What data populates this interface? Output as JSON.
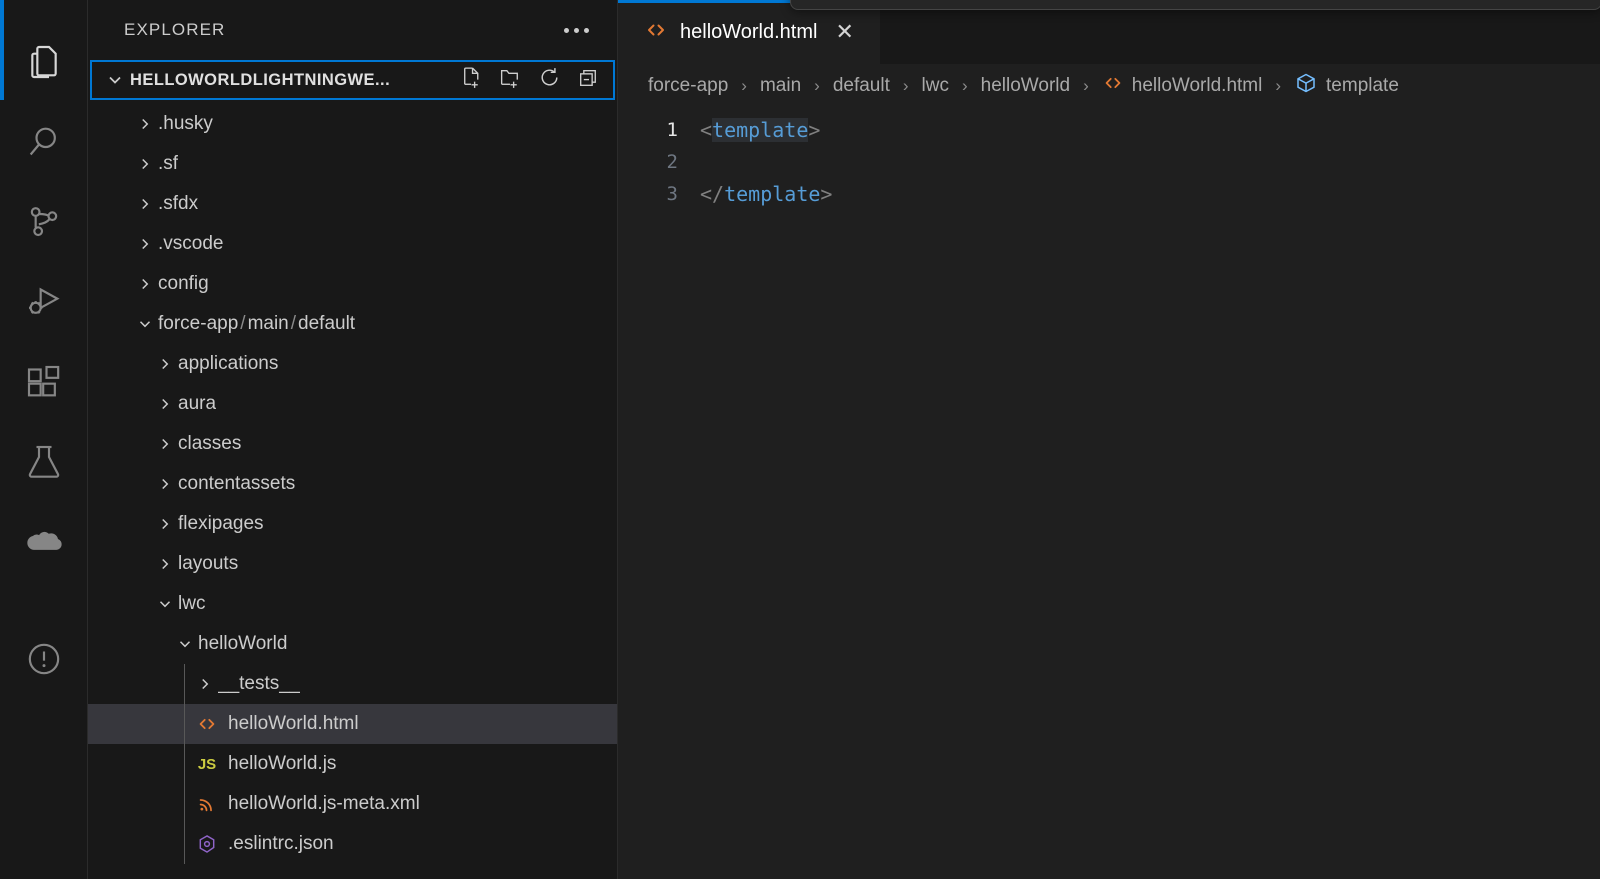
{
  "activitybar": {
    "items": [
      {
        "name": "explorer",
        "icon": "files-icon",
        "active": true
      },
      {
        "name": "search",
        "icon": "search-icon",
        "active": false
      },
      {
        "name": "source-control",
        "icon": "source-control-icon",
        "active": false
      },
      {
        "name": "run-and-debug",
        "icon": "run-debug-icon",
        "active": false
      },
      {
        "name": "extensions",
        "icon": "extensions-icon",
        "active": false
      },
      {
        "name": "testing",
        "icon": "beaker-icon",
        "active": false
      },
      {
        "name": "salesforce",
        "icon": "cloud-icon",
        "active": false
      },
      {
        "name": "problems",
        "icon": "warning-circle-icon",
        "active": false
      }
    ]
  },
  "sidebar": {
    "title": "EXPLORER",
    "more_actions_label": "...",
    "root": {
      "label": "HELLOWORLDLIGHTNINGWE...",
      "expanded": true,
      "actions": [
        {
          "name": "new-file",
          "label": "New File..."
        },
        {
          "name": "new-folder",
          "label": "New Folder..."
        },
        {
          "name": "refresh-explorer",
          "label": "Refresh Explorer"
        },
        {
          "name": "collapse-folders",
          "label": "Collapse Folders in Explorer"
        }
      ]
    },
    "tree": [
      {
        "label": ".husky",
        "kind": "folder",
        "expanded": false,
        "depth": 1
      },
      {
        "label": ".sf",
        "kind": "folder",
        "expanded": false,
        "depth": 1
      },
      {
        "label": ".sfdx",
        "kind": "folder",
        "expanded": false,
        "depth": 1
      },
      {
        "label": ".vscode",
        "kind": "folder",
        "expanded": false,
        "depth": 1
      },
      {
        "label": "config",
        "kind": "folder",
        "expanded": false,
        "depth": 1
      },
      {
        "label": "force-app",
        "label2": "main",
        "label3": "default",
        "kind": "folder-compact",
        "expanded": true,
        "depth": 1
      },
      {
        "label": "applications",
        "kind": "folder",
        "expanded": false,
        "depth": 2
      },
      {
        "label": "aura",
        "kind": "folder",
        "expanded": false,
        "depth": 2
      },
      {
        "label": "classes",
        "kind": "folder",
        "expanded": false,
        "depth": 2
      },
      {
        "label": "contentassets",
        "kind": "folder",
        "expanded": false,
        "depth": 2
      },
      {
        "label": "flexipages",
        "kind": "folder",
        "expanded": false,
        "depth": 2
      },
      {
        "label": "layouts",
        "kind": "folder",
        "expanded": false,
        "depth": 2
      },
      {
        "label": "lwc",
        "kind": "folder",
        "expanded": true,
        "depth": 2
      },
      {
        "label": "helloWorld",
        "kind": "folder",
        "expanded": true,
        "depth": 3
      },
      {
        "label": "__tests__",
        "kind": "folder",
        "expanded": false,
        "depth": 4
      },
      {
        "label": "helloWorld.html",
        "kind": "file-html",
        "selected": true,
        "depth": 4
      },
      {
        "label": "helloWorld.js",
        "kind": "file-js",
        "depth": 4
      },
      {
        "label": "helloWorld.js-meta.xml",
        "kind": "file-xml",
        "depth": 4
      },
      {
        "label": ".eslintrc.json",
        "kind": "file-eslint",
        "depth": 4
      }
    ]
  },
  "editor": {
    "tab": {
      "title": "helloWorld.html",
      "icon": "html-file-icon",
      "close_label": "✕",
      "active": true
    },
    "breadcrumbs": [
      {
        "label": "force-app",
        "icon": null
      },
      {
        "label": "main",
        "icon": null
      },
      {
        "label": "default",
        "icon": null
      },
      {
        "label": "lwc",
        "icon": null
      },
      {
        "label": "helloWorld",
        "icon": null
      },
      {
        "label": "helloWorld.html",
        "icon": "html-file-icon"
      },
      {
        "label": "template",
        "icon": "symbol-cube-icon"
      }
    ],
    "breadcrumb_separator": "›",
    "lines": [
      {
        "number": "1",
        "current": true,
        "segments": [
          {
            "text": "<",
            "type": "punct"
          },
          {
            "text": "template",
            "type": "tag"
          },
          {
            "text": ">",
            "type": "punct"
          }
        ]
      },
      {
        "number": "2",
        "current": false,
        "segments": []
      },
      {
        "number": "3",
        "current": false,
        "segments": [
          {
            "text": "</",
            "type": "punct"
          },
          {
            "text": "template",
            "type": "tag-plain"
          },
          {
            "text": ">",
            "type": "punct"
          }
        ]
      }
    ]
  },
  "colors": {
    "accent": "#0078d4",
    "sidebar_bg": "#181818",
    "editor_bg": "#1f1f1f",
    "selection_bg": "#37373d",
    "html_icon": "#e37933",
    "js_icon": "#cbcb41",
    "tag_color": "#569cd6",
    "eslint_icon": "#8f64c8"
  }
}
